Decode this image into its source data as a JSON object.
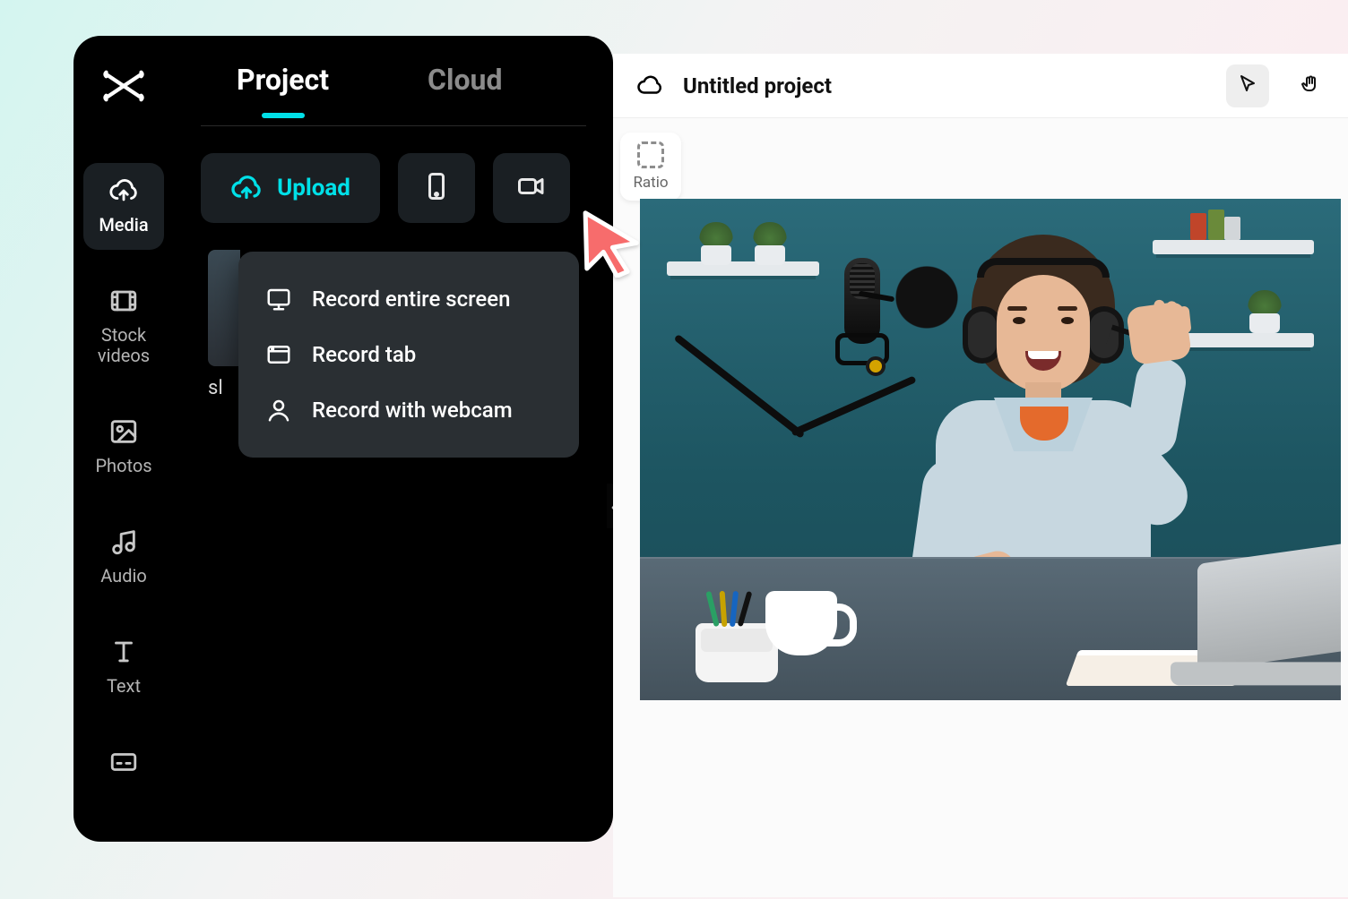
{
  "sidebar": {
    "items": [
      {
        "label": "Media"
      },
      {
        "label": "Stock\nvideos"
      },
      {
        "label": "Photos"
      },
      {
        "label": "Audio"
      },
      {
        "label": "Text"
      }
    ]
  },
  "tabs": {
    "project": "Project",
    "cloud": "Cloud"
  },
  "upload": {
    "label": "Upload"
  },
  "thumbnail": {
    "label_partial": "sl"
  },
  "dropdown": {
    "record_screen": "Record entire screen",
    "record_tab": "Record tab",
    "record_webcam": "Record with webcam"
  },
  "titlebar": {
    "project_name": "Untitled project"
  },
  "ratio": {
    "label": "Ratio"
  },
  "collapse_handle": "‹"
}
